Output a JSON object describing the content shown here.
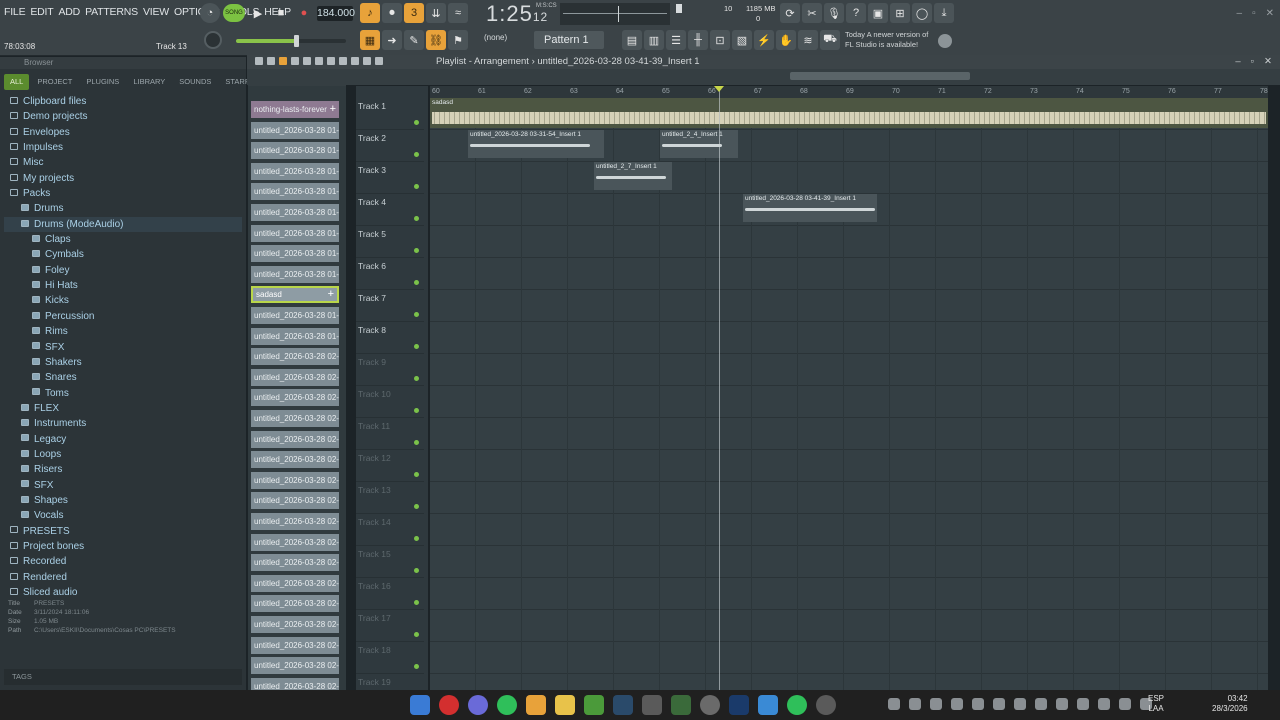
{
  "menu": [
    "FILE",
    "EDIT",
    "ADD",
    "PATTERNS",
    "VIEW",
    "OPTIONS",
    "TOOLS",
    "HELP"
  ],
  "hint": {
    "time": "78:03:08",
    "track": "Track 13"
  },
  "transport": {
    "mode": "SONG",
    "bpm": "184.000",
    "time_main": "1:25",
    "time_sub": "12",
    "time_units": "M:S:CS"
  },
  "perf": {
    "cpu": "10",
    "mem": "1185 MB",
    "poly": "0"
  },
  "pattern": {
    "none": "(none)",
    "name": "Pattern 1"
  },
  "news": {
    "line1": "Today  A newer version of",
    "line2": "FL Studio is available!"
  },
  "browser": {
    "title": "Browser",
    "tabs": [
      "ALL",
      "PROJECT",
      "PLUGINS",
      "LIBRARY",
      "SOUNDS",
      "STARRED"
    ],
    "items": [
      {
        "label": "Clipboard files",
        "indent": 0
      },
      {
        "label": "Demo projects",
        "indent": 0
      },
      {
        "label": "Envelopes",
        "indent": 0
      },
      {
        "label": "Impulses",
        "indent": 0
      },
      {
        "label": "Misc",
        "indent": 0
      },
      {
        "label": "My projects",
        "indent": 0
      },
      {
        "label": "Packs",
        "indent": 0
      },
      {
        "label": "Drums",
        "indent": 1
      },
      {
        "label": "Drums (ModeAudio)",
        "indent": 1
      },
      {
        "label": "Claps",
        "indent": 2
      },
      {
        "label": "Cymbals",
        "indent": 2
      },
      {
        "label": "Foley",
        "indent": 2
      },
      {
        "label": "Hi Hats",
        "indent": 2
      },
      {
        "label": "Kicks",
        "indent": 2
      },
      {
        "label": "Percussion",
        "indent": 2
      },
      {
        "label": "Rims",
        "indent": 2
      },
      {
        "label": "SFX",
        "indent": 2
      },
      {
        "label": "Shakers",
        "indent": 2
      },
      {
        "label": "Snares",
        "indent": 2
      },
      {
        "label": "Toms",
        "indent": 2
      },
      {
        "label": "FLEX",
        "indent": 1
      },
      {
        "label": "Instruments",
        "indent": 1
      },
      {
        "label": "Legacy",
        "indent": 1
      },
      {
        "label": "Loops",
        "indent": 1
      },
      {
        "label": "Risers",
        "indent": 1
      },
      {
        "label": "SFX",
        "indent": 1
      },
      {
        "label": "Shapes",
        "indent": 1
      },
      {
        "label": "Vocals",
        "indent": 1
      },
      {
        "label": "PRESETS",
        "indent": 0
      },
      {
        "label": "Project bones",
        "indent": 0
      },
      {
        "label": "Recorded",
        "indent": 0
      },
      {
        "label": "Rendered",
        "indent": 0
      },
      {
        "label": "Sliced audio",
        "indent": 0
      }
    ],
    "meta": {
      "title_k": "Title",
      "title_v": "PRESETS",
      "date_k": "Date",
      "date_v": "3/11/2024 18:11:06",
      "size_k": "Size",
      "size_v": "1.05 MB",
      "path_k": "Path",
      "path_v": "C:\\Users\\ESKII\\Documents\\Cosas PC\\PRESETS"
    },
    "tags": "TAGS"
  },
  "channels": [
    "nothing-lasts-forever",
    "untitled_2026-03-28 01-...",
    "untitled_2026-03-28 01-...",
    "untitled_2026-03-28 01-...",
    "untitled_2026-03-28 01-...",
    "untitled_2026-03-28 01-...",
    "untitled_2026-03-28 01-...",
    "untitled_2026-03-28 01-...",
    "untitled_2026-03-28 01-...",
    "sadasd",
    "untitled_2026-03-28 01-...",
    "untitled_2026-03-28 01-...",
    "untitled_2026-03-28 02-...",
    "untitled_2026-03-28 02-...",
    "untitled_2026-03-28 02-...",
    "untitled_2026-03-28 02-...",
    "untitled_2026-03-28 02-...",
    "untitled_2026-03-28 02-...",
    "untitled_2026-03-28 02-...",
    "untitled_2026-03-28 02-...",
    "untitled_2026-03-28 02-...",
    "untitled_2026-03-28 02-...",
    "untitled_2026-03-28 02-...",
    "untitled_2026-03-28 02-...",
    "untitled_2026-03-28 02-...",
    "untitled_2026-03-28 02-...",
    "untitled_2026-03-28 02-...",
    "untitled_2026-03-28 02-...",
    "untitled_2026-03-28 02-..."
  ],
  "playlist": {
    "title": "Playlist - Arrangement",
    "subtitle": "untitled_2026-03-28 03-41-39_Insert 1",
    "tracks": [
      "Track 1",
      "Track 2",
      "Track 3",
      "Track 4",
      "Track 5",
      "Track 6",
      "Track 7",
      "Track 8",
      "Track 9",
      "Track 10",
      "Track 11",
      "Track 12",
      "Track 13",
      "Track 14",
      "Track 15",
      "Track 16",
      "Track 17",
      "Track 18",
      "Track 19"
    ],
    "ruler": [
      "60",
      "61",
      "62",
      "63",
      "64",
      "65",
      "66",
      "67",
      "68",
      "69",
      "70",
      "71",
      "72",
      "73",
      "74",
      "75",
      "76",
      "77",
      "78"
    ],
    "clips": {
      "c1": "sadasd",
      "c2": "untitled_2026-03-28 03-31-54_Insert 1",
      "c3": "untitled_2_4_Insert 1",
      "c4": "untitled_2_7_Insert 1",
      "c5": "untitled_2026-03-28 03-41-39_Insert 1"
    }
  },
  "taskbar": {
    "lang1": "ESP",
    "lang2": "LAA",
    "time": "03:42",
    "date": "28/3/2026"
  }
}
